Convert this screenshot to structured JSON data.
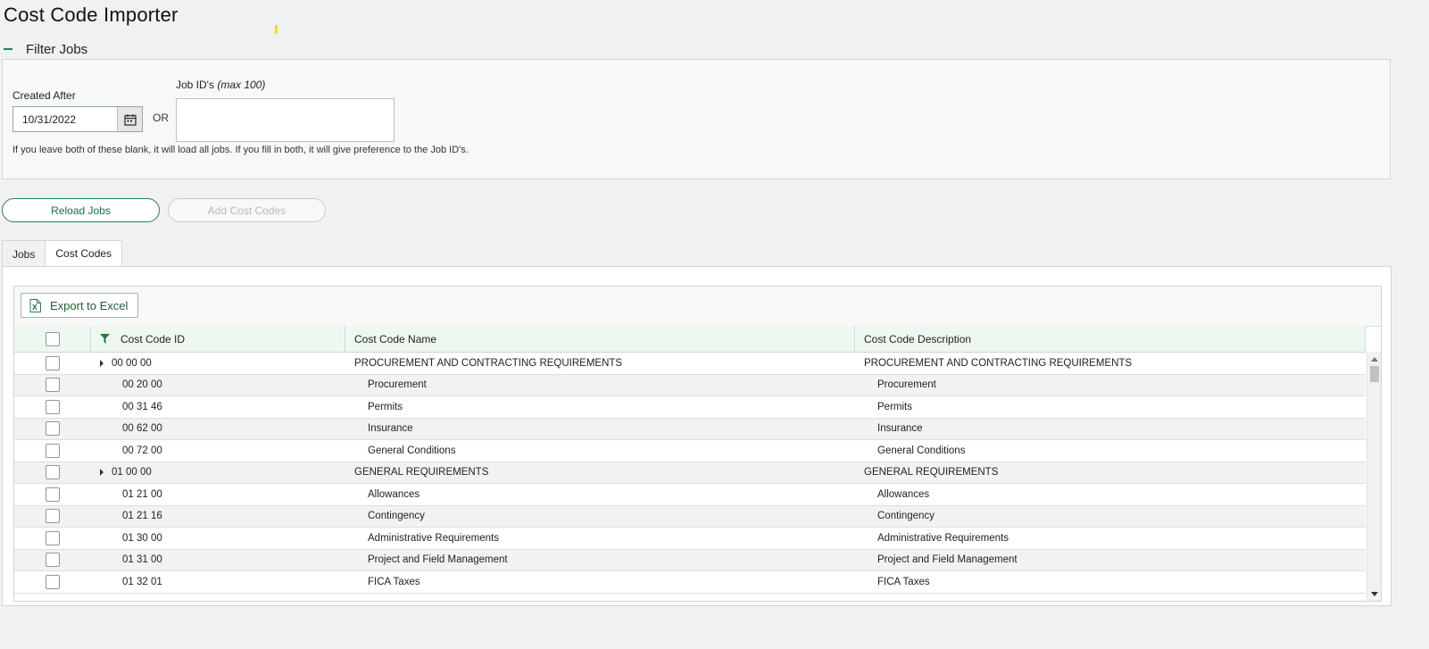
{
  "page": {
    "title": "Cost Code Importer"
  },
  "filter": {
    "section_label": "Filter Jobs",
    "created_after_label": "Created After",
    "created_after_value": "10/31/2022",
    "or_label": "OR",
    "job_ids_label": "Job ID's",
    "job_ids_hint": "(max 100)",
    "job_ids_value": "",
    "help_text": "If you leave both of these blank, it will load all jobs. If you fill in both, it will give preference to the Job ID's."
  },
  "actions": {
    "reload_label": "Reload Jobs",
    "add_label": "Add Cost Codes"
  },
  "tabs": [
    {
      "label": "Jobs",
      "active": false
    },
    {
      "label": "Cost Codes",
      "active": true
    }
  ],
  "grid": {
    "export_label": "Export to Excel",
    "columns": [
      "Cost Code ID",
      "Cost Code Name",
      "Cost Code Description"
    ],
    "rows": [
      {
        "id": "00 00 00",
        "name": "PROCUREMENT AND CONTRACTING REQUIREMENTS",
        "description": "PROCUREMENT AND CONTRACTING REQUIREMENTS",
        "group": true
      },
      {
        "id": "00 20 00",
        "name": "Procurement",
        "description": "Procurement",
        "group": false
      },
      {
        "id": "00 31 46",
        "name": "Permits",
        "description": "Permits",
        "group": false
      },
      {
        "id": "00 62 00",
        "name": "Insurance",
        "description": "Insurance",
        "group": false
      },
      {
        "id": "00 72 00",
        "name": "General Conditions",
        "description": "General Conditions",
        "group": false
      },
      {
        "id": "01 00 00",
        "name": "GENERAL REQUIREMENTS",
        "description": "GENERAL REQUIREMENTS",
        "group": true
      },
      {
        "id": "01 21 00",
        "name": "Allowances",
        "description": "Allowances",
        "group": false
      },
      {
        "id": "01 21 16",
        "name": "Contingency",
        "description": "Contingency",
        "group": false
      },
      {
        "id": "01 30 00",
        "name": "Administrative Requirements",
        "description": "Administrative Requirements",
        "group": false
      },
      {
        "id": "01 31 00",
        "name": "Project and Field Management",
        "description": "Project and Field Management",
        "group": false
      },
      {
        "id": "01 32 01",
        "name": "FICA Taxes",
        "description": "FICA Taxes",
        "group": false
      }
    ]
  },
  "colors": {
    "accent": "#2e7d52",
    "header_bg": "#eef8f1"
  },
  "icons": {
    "collapse": "minus-icon",
    "calendar": "calendar-icon",
    "export": "excel-icon",
    "filter": "filter-icon"
  }
}
